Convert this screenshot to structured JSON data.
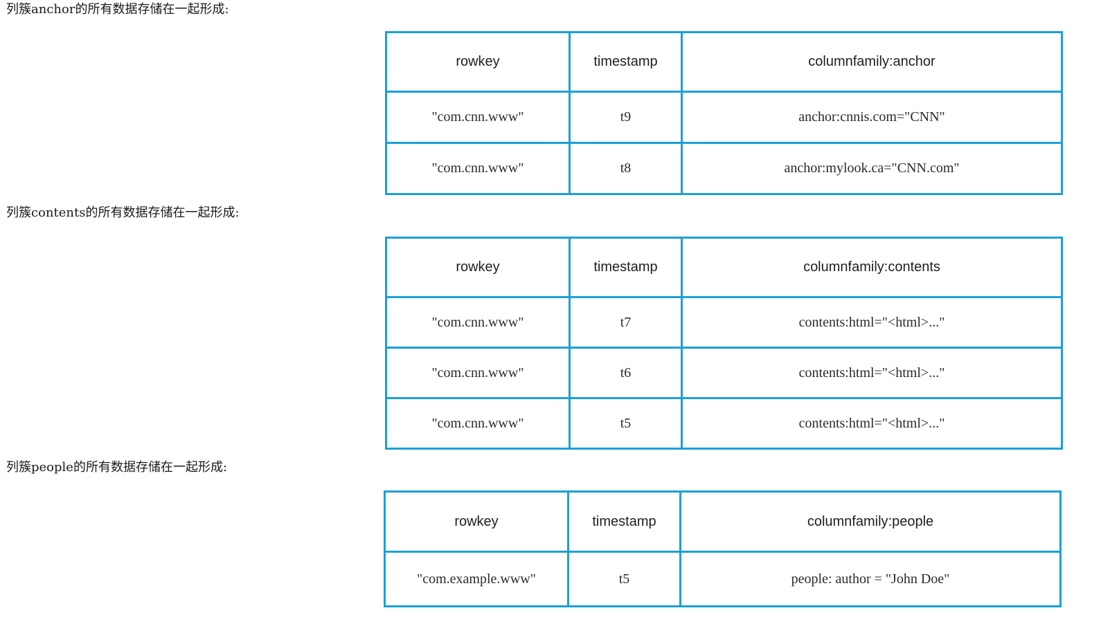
{
  "sections": [
    {
      "caption": "列簇anchor的所有数据存储在一起形成:",
      "headers": [
        "rowkey",
        "timestamp",
        "columnfamily:anchor"
      ],
      "rows": [
        [
          "\"com.cnn.www\"",
          "t9",
          "anchor:cnnis.com=\"CNN\""
        ],
        [
          "\"com.cnn.www\"",
          "t8",
          "anchor:mylook.ca=\"CNN.com\""
        ]
      ]
    },
    {
      "caption": "列簇contents的所有数据存储在一起形成:",
      "headers": [
        "rowkey",
        "timestamp",
        "columnfamily:contents"
      ],
      "rows": [
        [
          "\"com.cnn.www\"",
          "t7",
          "contents:html=\"<html>...\""
        ],
        [
          "\"com.cnn.www\"",
          "t6",
          "contents:html=\"<html>...\""
        ],
        [
          "\"com.cnn.www\"",
          "t5",
          "contents:html=\"<html>...\""
        ]
      ]
    },
    {
      "caption": "列簇people的所有数据存储在一起形成:",
      "headers": [
        "rowkey",
        "timestamp",
        "columnfamily:people"
      ],
      "rows": [
        [
          "\"com.example.www\"",
          "t5",
          "people: author = \"John Doe\""
        ]
      ]
    }
  ],
  "colors": {
    "table_border": "#1aa0d8",
    "text": "#222222"
  }
}
